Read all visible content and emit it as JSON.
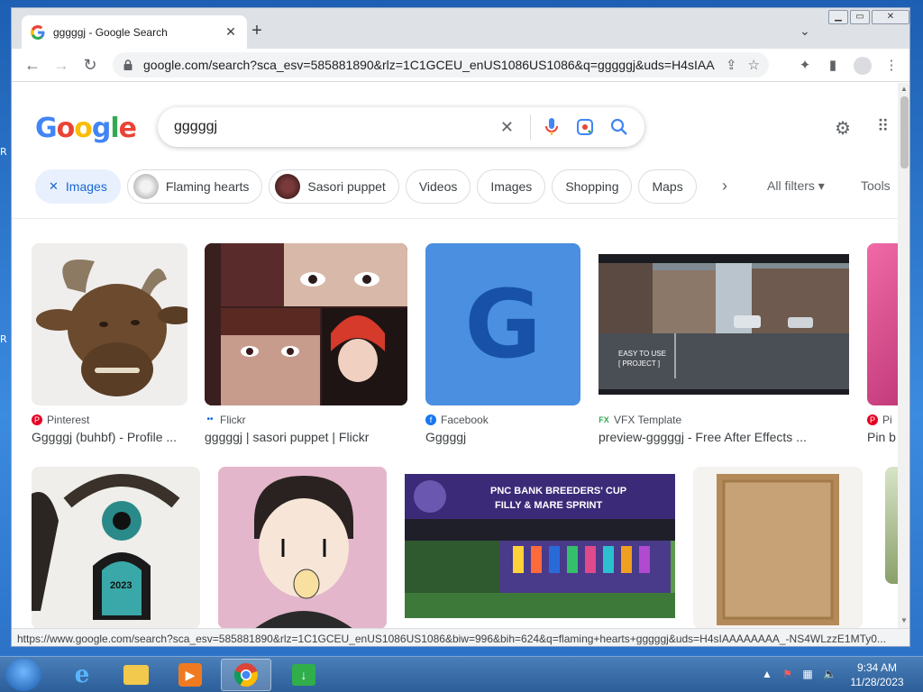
{
  "browser": {
    "tab_title": "gggggj - Google Search",
    "url": "google.com/search?sca_esv=585881890&rlz=1C1GCEU_enUS1086US1086&q=gggggj&uds=H4sIAAA...",
    "status_url": "https://www.google.com/search?sca_esv=585881890&rlz=1C1GCEU_enUS1086US1086&biw=996&bih=624&q=flaming+hearts+gggggj&uds=H4sIAAAAAAAA_-NS4WLzzE1MTy0..."
  },
  "search": {
    "query": "gggggj",
    "logo_letters": [
      "G",
      "o",
      "o",
      "g",
      "l",
      "e"
    ],
    "logo_colors": [
      "#4285F4",
      "#EA4335",
      "#FBBC05",
      "#4285F4",
      "#34A853",
      "#EA4335"
    ]
  },
  "chips": [
    {
      "label": "Images",
      "active": true,
      "icon": "close-icon"
    },
    {
      "label": "Flaming hearts",
      "thumb": true
    },
    {
      "label": "Sasori puppet",
      "thumb": true
    },
    {
      "label": "Videos"
    },
    {
      "label": "Images"
    },
    {
      "label": "Shopping"
    },
    {
      "label": "Maps"
    }
  ],
  "filters": {
    "all_filters": "All filters",
    "tools": "Tools"
  },
  "results": [
    {
      "source": "Pinterest",
      "caption": "Gggggj (buhbf) - Profile ...",
      "source_icon": "pinterest-icon",
      "source_color": "#e60023"
    },
    {
      "source": "Flickr",
      "caption": "gggggj | sasori puppet | Flickr",
      "source_icon": "flickr-icon",
      "source_color": "#0063dc"
    },
    {
      "source": "Facebook",
      "caption": "Gggggj",
      "source_icon": "facebook-icon",
      "source_color": "#1877f2"
    },
    {
      "source": "VFX Template",
      "caption": "preview-gggggj - Free After Effects ...",
      "source_icon": "vfx-icon",
      "source_color": "#34a853"
    },
    {
      "source": "Pi",
      "caption": "Pin b",
      "source_icon": "pinterest-icon",
      "source_color": "#e60023"
    }
  ],
  "row2": {
    "breeders_line1": "PNC BANK BREEDERS' CUP",
    "breeders_line2": "FILLY & MARE SPRINT",
    "badge_2023": "2023",
    "vfx_overlay_1": "EASY TO USE",
    "vfx_overlay_2": "[ PROJECT ]",
    "fb_letter": "G"
  },
  "taskbar": {
    "time": "9:34 AM",
    "date": "11/28/2023"
  }
}
